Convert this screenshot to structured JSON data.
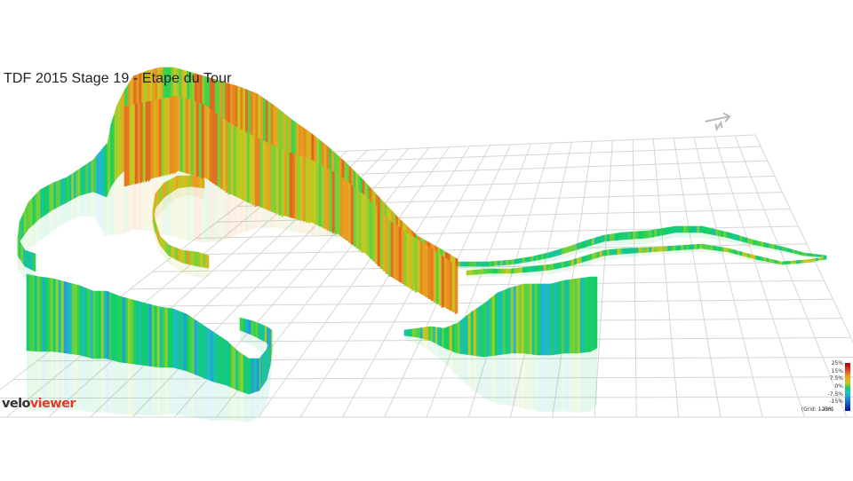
{
  "title": "TDF 2015 Stage 19 - Etape du Tour",
  "brand": {
    "part1": "velo",
    "part2": "viewer"
  },
  "legend": {
    "stops": [
      "25%",
      "15%",
      "7.5%",
      "0%",
      "-7.5%",
      "-15%",
      "-25%"
    ],
    "grid_note": "(Grid: 1 km)"
  },
  "compass_icon": "north-arrow-icon",
  "colors": {
    "grid": "#d6d6d6",
    "steep_up": "#c01810",
    "moderate_up": "#e8a020",
    "flat": "#10d060",
    "down": "#2060e0",
    "steep_down": "#0010a0",
    "logo_accent": "#e03a2a"
  }
}
